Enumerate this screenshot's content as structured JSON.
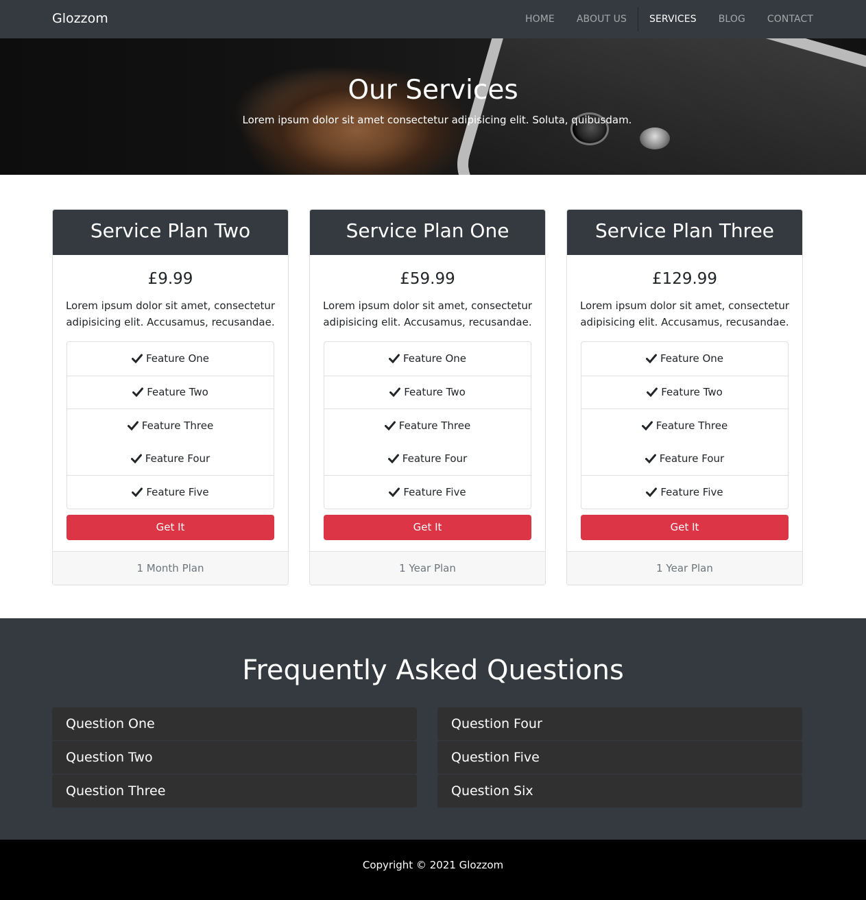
{
  "navbar": {
    "brand": "Glozzom",
    "items": [
      {
        "label": "HOME"
      },
      {
        "label": "ABOUT US"
      },
      {
        "label": "SERVICES"
      },
      {
        "label": "BLOG"
      },
      {
        "label": "CONTACT"
      }
    ]
  },
  "hero": {
    "title": "Our Services",
    "subtitle": "Lorem ipsum dolor sit amet consectetur adipisicing elit. Soluta, quibusdam."
  },
  "plans": [
    {
      "name": "Service Plan Two",
      "price": "£9.99",
      "description": "Lorem ipsum dolor sit amet, consectetur adipisicing elit. Accusamus, recusandae.",
      "features": [
        "Feature One",
        "Feature Two",
        "Feature Three",
        "Feature Four",
        "Feature Five"
      ],
      "button": "Get It",
      "footer": "1 Month Plan"
    },
    {
      "name": "Service Plan One",
      "price": "£59.99",
      "description": "Lorem ipsum dolor sit amet, consectetur adipisicing elit. Accusamus, recusandae.",
      "features": [
        "Feature One",
        "Feature Two",
        "Feature Three",
        "Feature Four",
        "Feature Five"
      ],
      "button": "Get It",
      "footer": "1 Year Plan"
    },
    {
      "name": "Service Plan Three",
      "price": "£129.99",
      "description": "Lorem ipsum dolor sit amet, consectetur adipisicing elit. Accusamus, recusandae.",
      "features": [
        "Feature One",
        "Feature Two",
        "Feature Three",
        "Feature Four",
        "Feature Five"
      ],
      "button": "Get It",
      "footer": "1 Year Plan"
    }
  ],
  "faq": {
    "title": "Frequently Asked Questions",
    "left": [
      "Question One",
      "Question Two",
      "Question Three"
    ],
    "right": [
      "Question Four",
      "Question Five",
      "Question Six"
    ]
  },
  "footer": {
    "copyright": "Copyright © 2021 Glozzom"
  },
  "colors": {
    "dark": "#343a40",
    "accent": "#dc3545",
    "faq_item": "#303030",
    "footer_bg": "#000000"
  }
}
